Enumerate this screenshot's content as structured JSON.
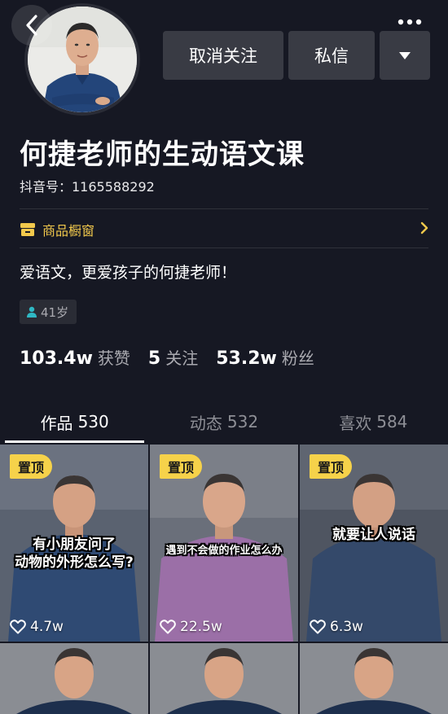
{
  "profile": {
    "name": "何捷老师的生动语文课",
    "douyin_id": "抖音号：1165588292",
    "bio": "爱语文，更爱孩子的何捷老师！",
    "age": "41岁"
  },
  "actions": {
    "unfollow_label": "取消关注",
    "message_label": "私信"
  },
  "shop": {
    "label": "商品橱窗"
  },
  "stats": {
    "likes_value": "103.4w",
    "likes_label": "获赞",
    "following_value": "5",
    "following_label": "关注",
    "followers_value": "53.2w",
    "followers_label": "粉丝"
  },
  "tabs": [
    {
      "label": "作品",
      "count": "530"
    },
    {
      "label": "动态",
      "count": "532"
    },
    {
      "label": "喜欢",
      "count": "584"
    }
  ],
  "videos": [
    {
      "pinned_label": "置顶",
      "caption_line1": "有小朋友问了",
      "caption_line2": "动物的外形怎么写?",
      "likes": "4.7w"
    },
    {
      "pinned_label": "置顶",
      "caption_line1": "遇到不会做的作业怎么办",
      "caption_line2": "",
      "likes": "22.5w"
    },
    {
      "pinned_label": "置顶",
      "caption_line1": "就要让人说话",
      "caption_line2": "",
      "likes": "6.3w"
    }
  ],
  "colors": {
    "background": "#161823",
    "accent_yellow": "#f6d24a",
    "shop_yellow": "#f2c94c",
    "button_gray": "#393b44"
  }
}
